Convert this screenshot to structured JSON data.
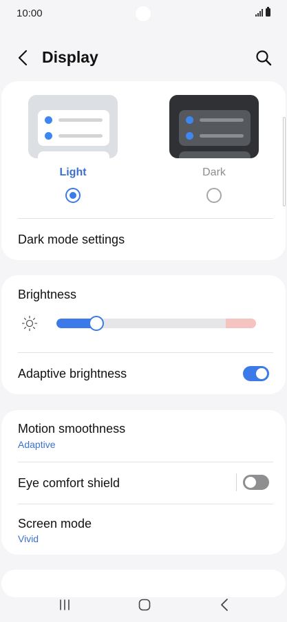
{
  "status_bar": {
    "time": "10:00"
  },
  "header": {
    "title": "Display"
  },
  "theme": {
    "options": [
      {
        "label": "Light",
        "selected": true
      },
      {
        "label": "Dark",
        "selected": false
      }
    ],
    "dark_mode_settings_label": "Dark mode settings"
  },
  "brightness": {
    "title": "Brightness",
    "level": 0.2,
    "adaptive_label": "Adaptive brightness",
    "adaptive_on": true
  },
  "display_options": {
    "motion_smoothness": {
      "title": "Motion smoothness",
      "value": "Adaptive"
    },
    "eye_comfort": {
      "title": "Eye comfort shield",
      "on": false
    },
    "screen_mode": {
      "title": "Screen mode",
      "value": "Vivid"
    }
  },
  "colors": {
    "accent": "#3b7ae8",
    "link_text": "#3b6fcf",
    "background": "#f5f5f7",
    "card": "#ffffff"
  },
  "icons": [
    "back-icon",
    "search-icon",
    "sun-icon",
    "nav-recent-icon",
    "nav-home-icon",
    "nav-back-icon"
  ]
}
